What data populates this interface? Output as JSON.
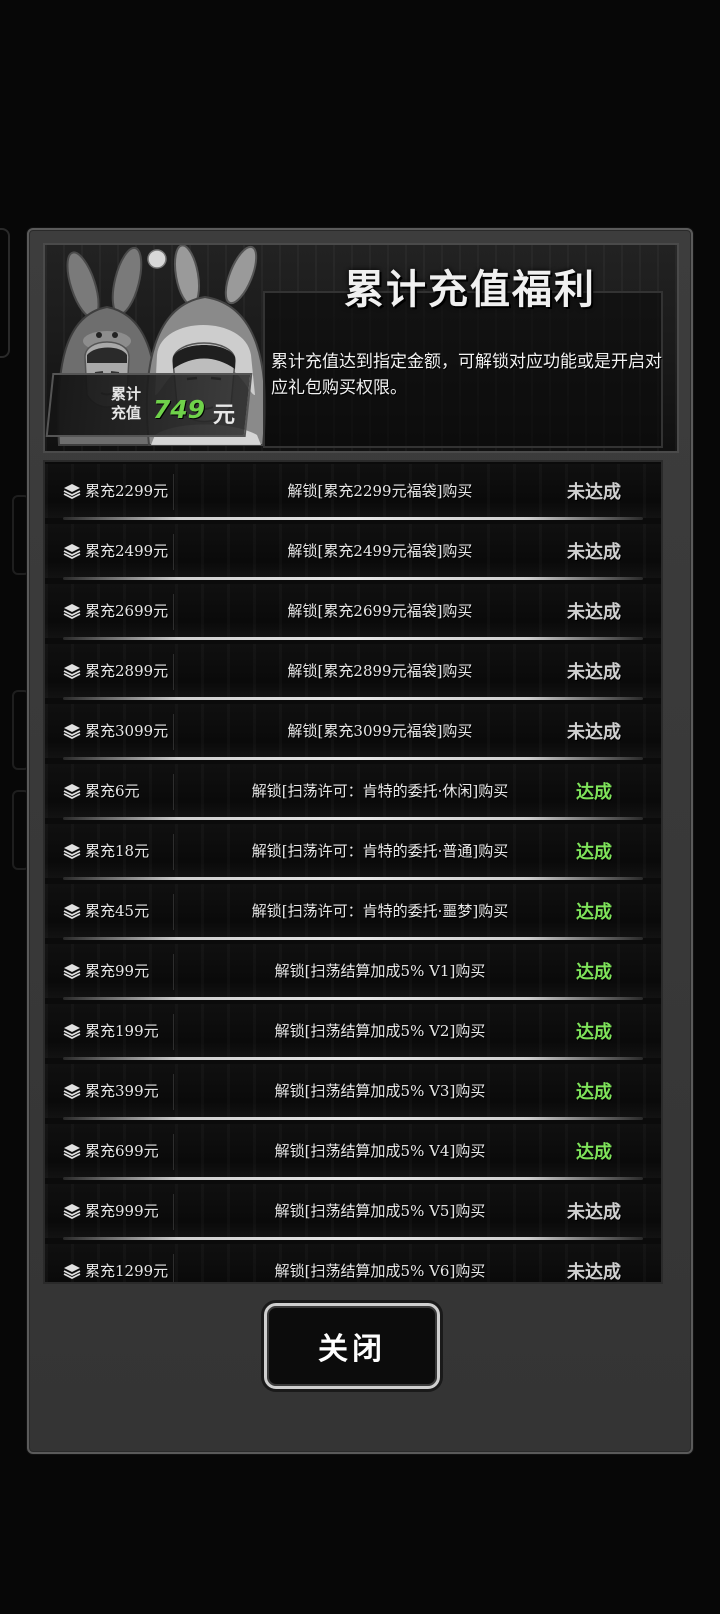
{
  "header": {
    "title": "累计充值福利",
    "description": "累计充值达到指定金额，可解锁对应功能或是开启对应礼包购买权限。",
    "total_label_line1": "累计",
    "total_label_line2": "充值",
    "total_value": "749",
    "total_unit": "元"
  },
  "rows": [
    {
      "tier": "累充2299元",
      "reward": "解锁[累充2299元福袋]购买",
      "status": "未达成",
      "achieved": false
    },
    {
      "tier": "累充2499元",
      "reward": "解锁[累充2499元福袋]购买",
      "status": "未达成",
      "achieved": false
    },
    {
      "tier": "累充2699元",
      "reward": "解锁[累充2699元福袋]购买",
      "status": "未达成",
      "achieved": false
    },
    {
      "tier": "累充2899元",
      "reward": "解锁[累充2899元福袋]购买",
      "status": "未达成",
      "achieved": false
    },
    {
      "tier": "累充3099元",
      "reward": "解锁[累充3099元福袋]购买",
      "status": "未达成",
      "achieved": false
    },
    {
      "tier": "累充6元",
      "reward": "解锁[扫荡许可：肯特的委托·休闲]购买",
      "status": "达成",
      "achieved": true
    },
    {
      "tier": "累充18元",
      "reward": "解锁[扫荡许可：肯特的委托·普通]购买",
      "status": "达成",
      "achieved": true
    },
    {
      "tier": "累充45元",
      "reward": "解锁[扫荡许可：肯特的委托·噩梦]购买",
      "status": "达成",
      "achieved": true
    },
    {
      "tier": "累充99元",
      "reward": "解锁[扫荡结算加成5% V1]购买",
      "status": "达成",
      "achieved": true
    },
    {
      "tier": "累充199元",
      "reward": "解锁[扫荡结算加成5% V2]购买",
      "status": "达成",
      "achieved": true
    },
    {
      "tier": "累充399元",
      "reward": "解锁[扫荡结算加成5% V3]购买",
      "status": "达成",
      "achieved": true
    },
    {
      "tier": "累充699元",
      "reward": "解锁[扫荡结算加成5% V4]购买",
      "status": "达成",
      "achieved": true
    },
    {
      "tier": "累充999元",
      "reward": "解锁[扫荡结算加成5% V5]购买",
      "status": "未达成",
      "achieved": false
    },
    {
      "tier": "累充1299元",
      "reward": "解锁[扫荡结算加成5% V6]购买",
      "status": "未达成",
      "achieved": false
    }
  ],
  "row_icon": "layers-icon",
  "colors": {
    "achieved": "#7ee25a",
    "not_achieved": "#cfcfcf",
    "total_value": "#6fd24a"
  },
  "footer": {
    "close_label": "关闭"
  }
}
